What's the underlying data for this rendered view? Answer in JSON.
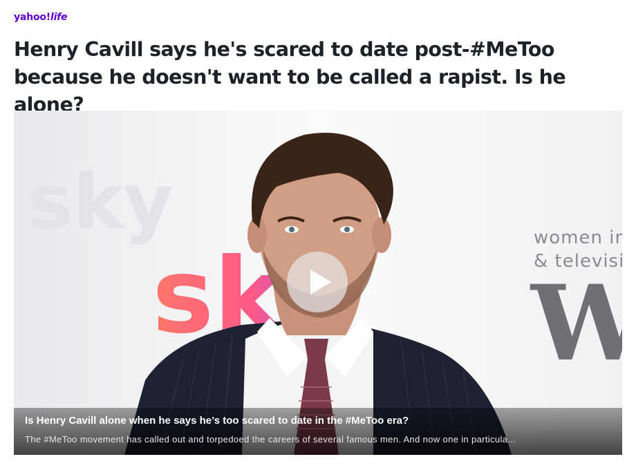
{
  "brand": {
    "logo_text": "yahoo!",
    "section_text": "life",
    "color": "#6001d2"
  },
  "article": {
    "headline": "Henry Cavill says he's scared to date post-#MeToo because he doesn't want to be called a rapist. Is he alone?"
  },
  "video": {
    "backdrop": {
      "sponsor_logo_text": "sky",
      "banner_line_1": "women in",
      "banner_line_2": "& television",
      "banner_initial": "W"
    },
    "play_icon": "play-icon",
    "caption_title": "Is Henry Cavill alone when he says he’s too scared to date in the #MeToo era?",
    "caption_description": "The #MeToo movement has called out and torpedoed the careers of several famous men. And now one in particula..."
  }
}
